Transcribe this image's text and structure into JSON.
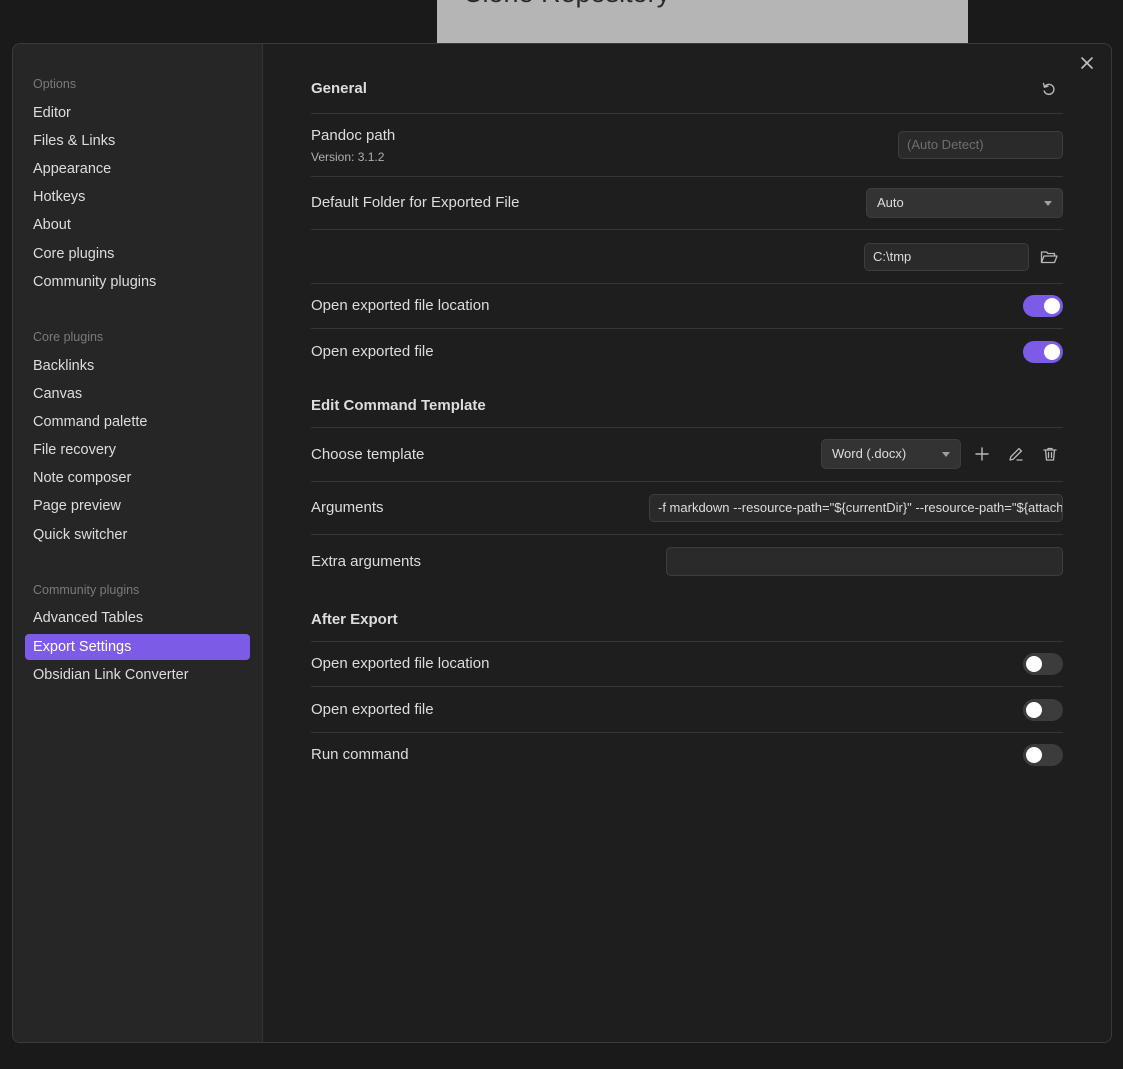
{
  "background": {
    "window_title": "Clone Repository"
  },
  "sidebar": {
    "groups": [
      {
        "title": "Options",
        "items": [
          "Editor",
          "Files & Links",
          "Appearance",
          "Hotkeys",
          "About",
          "Core plugins",
          "Community plugins"
        ]
      },
      {
        "title": "Core plugins",
        "items": [
          "Backlinks",
          "Canvas",
          "Command palette",
          "File recovery",
          "Note composer",
          "Page preview",
          "Quick switcher"
        ]
      },
      {
        "title": "Community plugins",
        "items": [
          "Advanced Tables",
          "Export Settings",
          "Obsidian Link Converter"
        ]
      }
    ],
    "active_item": "Export Settings"
  },
  "general": {
    "heading": "General",
    "pandoc_path": {
      "label": "Pandoc path",
      "version": "Version: 3.1.2",
      "placeholder": "(Auto Detect)",
      "value": ""
    },
    "default_folder": {
      "label": "Default Folder for Exported File",
      "selected": "Auto"
    },
    "folder_path": {
      "value": "C:\\tmp"
    },
    "open_location": {
      "label": "Open exported file location",
      "on": true
    },
    "open_file": {
      "label": "Open exported file",
      "on": true
    }
  },
  "edit_command_template": {
    "heading": "Edit Command Template",
    "choose_template": {
      "label": "Choose template",
      "selected": "Word (.docx)"
    },
    "arguments": {
      "label": "Arguments",
      "value": "-f markdown --resource-path=\"${currentDir}\" --resource-path=\"${attachmentFolderPath}\""
    },
    "extra_arguments": {
      "label": "Extra arguments",
      "value": ""
    }
  },
  "after_export": {
    "heading": "After Export",
    "open_location": {
      "label": "Open exported file location",
      "on": false
    },
    "open_file": {
      "label": "Open exported file",
      "on": false
    },
    "run_command": {
      "label": "Run command",
      "on": false
    }
  },
  "colors": {
    "accent": "#7c5ce6",
    "panel": "#1e1e1e",
    "sidebar": "#262626"
  },
  "icons": {
    "close": "close-icon",
    "reset": "reset-icon",
    "folder": "folder-open-icon",
    "add": "plus-icon",
    "edit": "pencil-icon",
    "delete": "trash-icon"
  }
}
